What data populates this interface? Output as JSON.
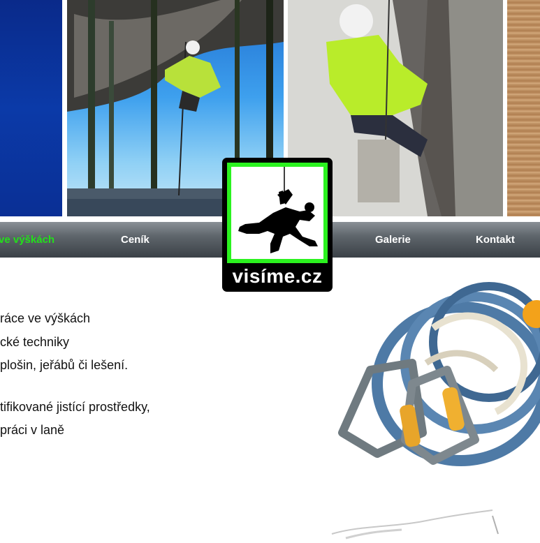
{
  "nav": {
    "items": [
      {
        "label": "ve výškách",
        "active": true
      },
      {
        "label": "Ceník",
        "active": false
      },
      {
        "label": "Galerie",
        "active": false
      },
      {
        "label": "Kontakt",
        "active": false
      }
    ]
  },
  "logo": {
    "text": "visíme.cz"
  },
  "content": {
    "lines": [
      "ráce ve výškách",
      "cké techniky",
      "plošin, jeřábů či lešení.",
      "tifikované jistící prostředky,",
      "práci v laně"
    ]
  },
  "colors": {
    "accent": "#22e01a",
    "nav_dark": "#3b4147",
    "logo_green": "#2bf21f"
  },
  "icons": [
    "rope-climber-silhouette-icon"
  ]
}
